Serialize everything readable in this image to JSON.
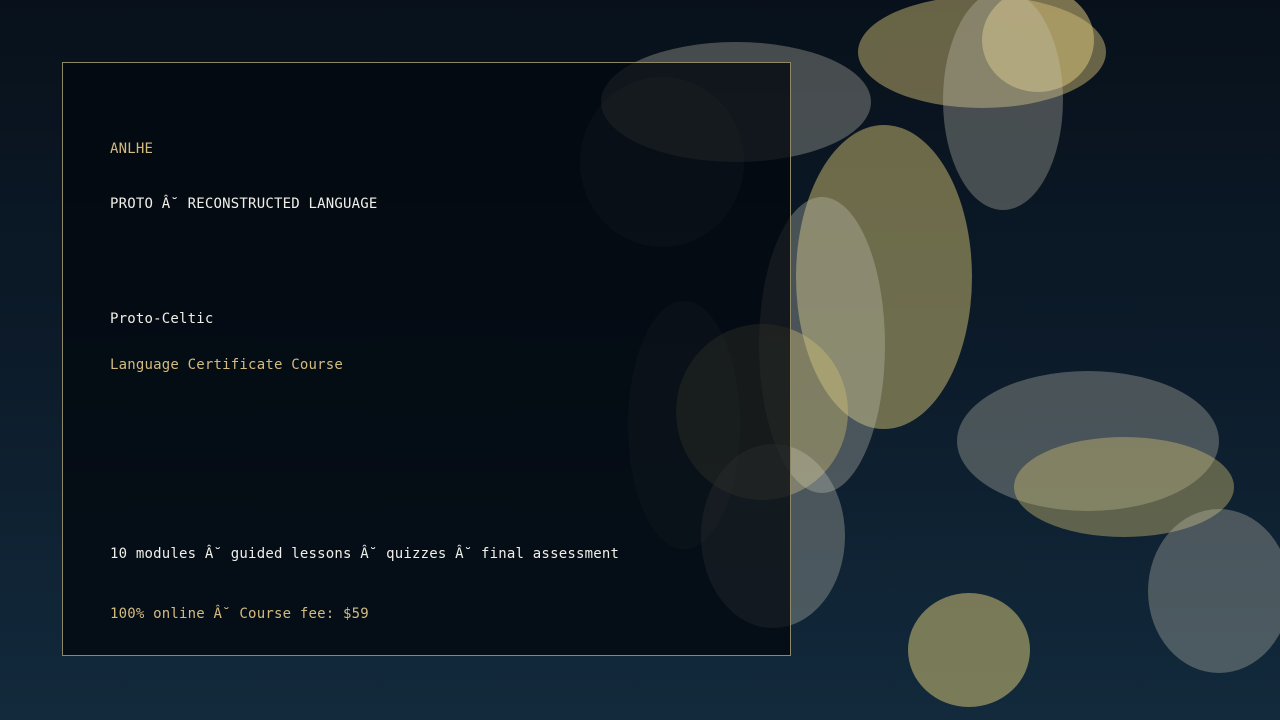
{
  "brand": "ANLHE",
  "kicker": "PROTO Â˘ RECONSTRUCTED LANGUAGE",
  "language_name": "Proto-Celtic",
  "course_title": "Language Certificate Course",
  "details_line": "10 modules Â˘ guided lessons Â˘ quizzes Â˘ final assessment",
  "pricing_line": "100% online Â˘ Course fee: $59",
  "colors": {
    "gold": "#d3bb80",
    "white": "#f0efe8",
    "panel_border": "#8e8866",
    "background_top": "#08111b",
    "background_bottom": "#122a3c"
  }
}
